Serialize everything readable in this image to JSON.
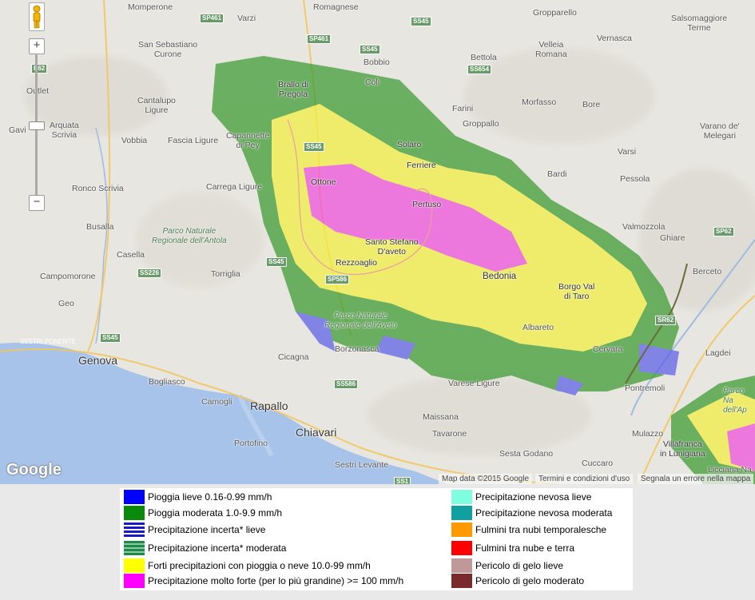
{
  "map": {
    "places": [
      {
        "id": "mompeorne",
        "label": "Momperone",
        "cls": ""
      },
      {
        "id": "varzi",
        "label": "Varzi",
        "cls": ""
      },
      {
        "id": "romagnese",
        "label": "Romagnese",
        "cls": ""
      },
      {
        "id": "gropparello",
        "label": "Gropparello",
        "cls": ""
      },
      {
        "id": "salsomaggiore",
        "label": "Salsomaggiore\nTerme",
        "cls": ""
      },
      {
        "id": "sansebastiano",
        "label": "San Sebastiano\nCurone",
        "cls": ""
      },
      {
        "id": "bobbio",
        "label": "Bobbio",
        "cls": ""
      },
      {
        "id": "bettola",
        "label": "Bettola",
        "cls": ""
      },
      {
        "id": "vernasca",
        "label": "Vernasca",
        "cls": ""
      },
      {
        "id": "vellerom",
        "label": "Velleia\nRomana",
        "cls": ""
      },
      {
        "id": "outlet",
        "label": "Outlet",
        "cls": ""
      },
      {
        "id": "brallo",
        "label": "Brallo di\nPregola",
        "cls": ""
      },
      {
        "id": "coli",
        "label": "Coli",
        "cls": ""
      },
      {
        "id": "cantalupo",
        "label": "Cantalupo\nLigure",
        "cls": ""
      },
      {
        "id": "farini",
        "label": "Farini",
        "cls": ""
      },
      {
        "id": "morfasso",
        "label": "Morfasso",
        "cls": ""
      },
      {
        "id": "bore",
        "label": "Bore",
        "cls": ""
      },
      {
        "id": "gavi",
        "label": "Gavi",
        "cls": ""
      },
      {
        "id": "arquata",
        "label": "Arquata\nScrivia",
        "cls": ""
      },
      {
        "id": "capannette",
        "label": "Capannette\ndi Pey",
        "cls": ""
      },
      {
        "id": "groppallo",
        "label": "Groppallo",
        "cls": ""
      },
      {
        "id": "varano",
        "label": "Varano de'\nMelegari",
        "cls": ""
      },
      {
        "id": "vobbia",
        "label": "Vobbia",
        "cls": ""
      },
      {
        "id": "fascia",
        "label": "Fascia Ligure",
        "cls": ""
      },
      {
        "id": "solaro",
        "label": "Solaro",
        "cls": ""
      },
      {
        "id": "varsi",
        "label": "Varsi",
        "cls": ""
      },
      {
        "id": "ferriere",
        "label": "Ferriere",
        "cls": ""
      },
      {
        "id": "bardi",
        "label": "Bardi",
        "cls": ""
      },
      {
        "id": "ronco",
        "label": "Ronco Scrivia",
        "cls": ""
      },
      {
        "id": "carrega",
        "label": "Carrega Ligure",
        "cls": ""
      },
      {
        "id": "ottone",
        "label": "Ottone",
        "cls": ""
      },
      {
        "id": "pessola",
        "label": "Pessola",
        "cls": ""
      },
      {
        "id": "busalla",
        "label": "Busalla",
        "cls": ""
      },
      {
        "id": "pertuso",
        "label": "Pertuso",
        "cls": ""
      },
      {
        "id": "valmozzola",
        "label": "Valmozzola",
        "cls": ""
      },
      {
        "id": "ghiare",
        "label": "Ghiare",
        "cls": ""
      },
      {
        "id": "antola",
        "label": "Parco Naturale\nRegionale dell'Antola",
        "cls": "park"
      },
      {
        "id": "ssaveto",
        "label": "Santo Stefano\nD'aveto",
        "cls": ""
      },
      {
        "id": "casella",
        "label": "Casella",
        "cls": ""
      },
      {
        "id": "rezzoaglio",
        "label": "Rezzoaglio",
        "cls": ""
      },
      {
        "id": "campomorone",
        "label": "Campomorone",
        "cls": ""
      },
      {
        "id": "torriglia",
        "label": "Torriglia",
        "cls": ""
      },
      {
        "id": "bedonia",
        "label": "Bedonia",
        "cls": ""
      },
      {
        "id": "borgovaltaro",
        "label": "Borgo Val\ndi Taro",
        "cls": ""
      },
      {
        "id": "berceto",
        "label": "Berceto",
        "cls": ""
      },
      {
        "id": "geo",
        "label": "Geo",
        "cls": ""
      },
      {
        "id": "aveto",
        "label": "Parco Naturale\nRegionale dell'Aveto",
        "cls": "park"
      },
      {
        "id": "albareto",
        "label": "Albareto",
        "cls": ""
      },
      {
        "id": "cervara",
        "label": "Cervara",
        "cls": ""
      },
      {
        "id": "lagdei",
        "label": "Lagdei",
        "cls": ""
      },
      {
        "id": "genova",
        "label": "Genova",
        "cls": "city"
      },
      {
        "id": "borzonasca",
        "label": "Borzonasca",
        "cls": ""
      },
      {
        "id": "cicagna",
        "label": "Cicagna",
        "cls": ""
      },
      {
        "id": "bogliasco",
        "label": "Bogliasco",
        "cls": ""
      },
      {
        "id": "vareseligure",
        "label": "Varese Ligure",
        "cls": ""
      },
      {
        "id": "pontremoli",
        "label": "Pontremoli",
        "cls": ""
      },
      {
        "id": "camogli",
        "label": "Camogli",
        "cls": ""
      },
      {
        "id": "rapallo",
        "label": "Rapallo",
        "cls": "city"
      },
      {
        "id": "maissana",
        "label": "Maissana",
        "cls": ""
      },
      {
        "id": "tavarone",
        "label": "Tavarone",
        "cls": ""
      },
      {
        "id": "chiavari",
        "label": "Chiavari",
        "cls": "city"
      },
      {
        "id": "mulazzo",
        "label": "Mulazzo",
        "cls": ""
      },
      {
        "id": "villafranca",
        "label": "Villafranca\nin Lunigiana",
        "cls": ""
      },
      {
        "id": "portofino",
        "label": "Portofino",
        "cls": ""
      },
      {
        "id": "sestrilevante",
        "label": "Sestri Levante",
        "cls": ""
      },
      {
        "id": "sestagodano",
        "label": "Sesta Godano",
        "cls": ""
      },
      {
        "id": "cuccaro",
        "label": "Cuccaro",
        "cls": ""
      },
      {
        "id": "licciana",
        "label": "Licciana Na",
        "cls": ""
      },
      {
        "id": "sestriponente",
        "label": "SESTRI PONENTE",
        "cls": ""
      },
      {
        "id": "appennino",
        "label": "Parco Na\ndell'Ap",
        "cls": "park"
      }
    ],
    "roads": [
      {
        "id": "sp461a",
        "label": "SP461"
      },
      {
        "id": "ss45a",
        "label": "SS45"
      },
      {
        "id": "sp461b",
        "label": "SP461"
      },
      {
        "id": "ss45b",
        "label": "SS45"
      },
      {
        "id": "ss654",
        "label": "SS654"
      },
      {
        "id": "e62",
        "label": "E62"
      },
      {
        "id": "ss45c",
        "label": "SS45"
      },
      {
        "id": "sp62",
        "label": "SP62"
      },
      {
        "id": "ss45d",
        "label": "SS45"
      },
      {
        "id": "ss226",
        "label": "SS226"
      },
      {
        "id": "sp586",
        "label": "SP586"
      },
      {
        "id": "sr62",
        "label": "SR62"
      },
      {
        "id": "ss45e",
        "label": "SS45"
      },
      {
        "id": "ss586",
        "label": "SS586"
      },
      {
        "id": "ss1",
        "label": "SS1"
      }
    ],
    "zoom_in_label": "+",
    "zoom_out_label": "−",
    "google_logo": "Google",
    "map_data": "Map data ©2015 Google",
    "terms": "Termini e condizioni d'uso",
    "report": "Segnala un errore nella mappa",
    "colors": {
      "sea": "#a7c3ea",
      "land": "#e6e4df",
      "green": "#3a9a30",
      "yellow": "#f2ef3f",
      "magenta": "#ee4ddc",
      "blue": "#5a5ee8"
    }
  },
  "legend": {
    "left": [
      {
        "label": "Pioggia lieve 0.16-0.99 mm/h",
        "color": "#0000ff",
        "pattern": "solid"
      },
      {
        "label": "Pioggia moderata 1.0-9.9 mm/h",
        "color": "#0a8a0a",
        "pattern": "solid"
      },
      {
        "label": "Precipitazione incerta* lieve",
        "color": "#1a1acc",
        "pattern": "stripes"
      },
      {
        "label": "Precipitazione incerta* moderata",
        "color": "#1e8a4a",
        "pattern": "stripes"
      },
      {
        "label": "Forti precipitazioni con pioggia o neve 10.0-99 mm/h",
        "color": "#ffff00",
        "pattern": "solid"
      },
      {
        "label": "Precipitazione molto forte (per lo più grandine) >= 100 mm/h",
        "color": "#ff00ff",
        "pattern": "solid"
      }
    ],
    "right": [
      {
        "label": "Precipitazione nevosa lieve",
        "color": "#80ffe0",
        "pattern": "solid"
      },
      {
        "label": "Precipitazione nevosa moderata",
        "color": "#10a0a0",
        "pattern": "solid"
      },
      {
        "label": "Fulmini tra nubi temporalesche",
        "color": "#ff9900",
        "pattern": "solid"
      },
      {
        "label": "Fulmini tra nube e terra",
        "color": "#ff0000",
        "pattern": "solid"
      },
      {
        "label": "Pericolo di gelo lieve",
        "color": "#c09898",
        "pattern": "solid"
      },
      {
        "label": "Pericolo di gelo moderato",
        "color": "#7a2a2a",
        "pattern": "solid"
      }
    ]
  }
}
